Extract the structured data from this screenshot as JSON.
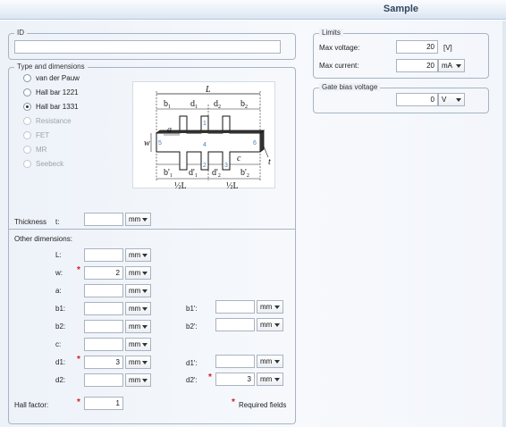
{
  "window": {
    "title": "Sample"
  },
  "id_group": {
    "legend": "ID",
    "value": ""
  },
  "type_group": {
    "legend": "Type and dimensions",
    "options": [
      {
        "label": "van der Pauw",
        "selected": false,
        "enabled": true
      },
      {
        "label": "Hall bar 1221",
        "selected": false,
        "enabled": true
      },
      {
        "label": "Hall bar 1331",
        "selected": true,
        "enabled": true
      },
      {
        "label": "Resistance",
        "selected": false,
        "enabled": false
      },
      {
        "label": "FET",
        "selected": false,
        "enabled": false
      },
      {
        "label": "MR",
        "selected": false,
        "enabled": false
      },
      {
        "label": "Seebeck",
        "selected": false,
        "enabled": false
      }
    ],
    "diagram_labels": {
      "L": "L",
      "b1": "b",
      "b1sub": "1",
      "d1": "d",
      "d1sub": "1",
      "d2": "d",
      "d2sub": "2",
      "b2": "b",
      "b2sub": "2",
      "w": "w",
      "a": "a",
      "c": "c",
      "t": "t",
      "p1": "1",
      "p2": "2",
      "p3": "3",
      "p4": "4",
      "p5": "5",
      "p6": "6",
      "b1p": "b'",
      "b1psub": "1",
      "d1p": "d'",
      "d1psub": "1",
      "d2p": "d'",
      "d2psub": "2",
      "b2p": "b'",
      "b2psub": "2",
      "half_left": "½L",
      "half_right": "½L"
    }
  },
  "thickness": {
    "label": "Thickness",
    "symbol": "t:",
    "value": "",
    "unit": "mm"
  },
  "other_dimensions_label": "Other dimensions:",
  "dims_left": [
    {
      "label": "L:",
      "value": "",
      "unit": "mm",
      "required": false
    },
    {
      "label": "w:",
      "value": "2",
      "unit": "mm",
      "required": true
    },
    {
      "label": "a:",
      "value": "",
      "unit": "mm",
      "required": false
    },
    {
      "label": "b1:",
      "value": "",
      "unit": "mm",
      "required": false
    },
    {
      "label": "b2:",
      "value": "",
      "unit": "mm",
      "required": false
    },
    {
      "label": "c:",
      "value": "",
      "unit": "mm",
      "required": false
    },
    {
      "label": "d1:",
      "value": "3",
      "unit": "mm",
      "required": true
    },
    {
      "label": "d2:",
      "value": "",
      "unit": "mm",
      "required": false
    }
  ],
  "dims_right": [
    {
      "label": "b1':",
      "value": "",
      "unit": "mm",
      "required": false
    },
    {
      "label": "b2':",
      "value": "",
      "unit": "mm",
      "required": false
    },
    {
      "label": "d1':",
      "value": "",
      "unit": "mm",
      "required": false
    },
    {
      "label": "d2':",
      "value": "3",
      "unit": "mm",
      "required": true
    }
  ],
  "hall_factor": {
    "label": "Hall factor:",
    "value": "1",
    "required": true
  },
  "required_note": "Required fields",
  "required_marker": "*",
  "limits": {
    "legend": "Limits",
    "max_voltage": {
      "label": "Max voltage:",
      "value": "20",
      "unit": "[V]"
    },
    "max_current": {
      "label": "Max current:",
      "value": "20",
      "unit": "mA"
    }
  },
  "gate_bias": {
    "legend": "Gate bias voltage",
    "value": "0",
    "unit": "V"
  }
}
